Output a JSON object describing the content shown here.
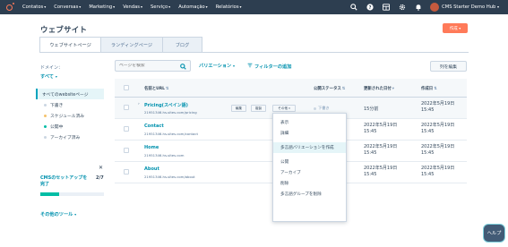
{
  "nav": {
    "items": [
      {
        "label": "Contatos"
      },
      {
        "label": "Conversas"
      },
      {
        "label": "Marketing"
      },
      {
        "label": "Vendas"
      },
      {
        "label": "Serviço"
      },
      {
        "label": "Automação"
      },
      {
        "label": "Relatórios"
      }
    ],
    "hub_name": "CMS Starter Demo Hub"
  },
  "header": {
    "title": "ウェブサイト",
    "create_label": "作成"
  },
  "tabs": [
    {
      "label": "ウェブサイトページ"
    },
    {
      "label": "ランディングページ"
    },
    {
      "label": "ブログ"
    }
  ],
  "sidebar": {
    "domain_label": "ドメイン：",
    "domain_value": "すべて",
    "items": [
      {
        "label": "すべてのwebsiteページ",
        "dot_color": ""
      },
      {
        "label": "下書き",
        "dot_color": "#cbd6e2"
      },
      {
        "label": "スケジュール済み",
        "dot_color": "#f5c26b"
      },
      {
        "label": "公開中",
        "dot_color": "#00bda5"
      },
      {
        "label": "アーカイブ済み",
        "dot_color": "#cbd6e2"
      }
    ],
    "setup_title": "CMSのセットアップを完了",
    "setup_count": "2/7",
    "setup_progress": 0.29,
    "more_tools": "その他のツール"
  },
  "toolbar": {
    "search_placeholder": "ページを検索",
    "variation": "バリエーション",
    "filter": "フィルターの追加",
    "edit_columns": "列を編集"
  },
  "table": {
    "headers": {
      "name": "名前とURL",
      "status": "公開ステータス",
      "updated": "更新された日付",
      "created": "作成日"
    },
    "rows": [
      {
        "name": "Pricing(スペイン語)",
        "url": "21951346.hs-sites.com/pricing",
        "btn_edit": "編集",
        "btn_clone": "複製",
        "btn_more": "その他",
        "status": "下書き",
        "updated": "15分前",
        "created_date": "2022年5月19日",
        "created_time": "15:45"
      },
      {
        "name": "Contact",
        "url": "21951346.hs-sites.com/contact",
        "status": "",
        "updated_date": "2022年5月19日",
        "updated_time": "15:45",
        "created_date": "2022年5月19日",
        "created_time": "15:45"
      },
      {
        "name": "Home",
        "url": "21951346.hs-sites.com",
        "status": "",
        "updated_date": "2022年5月19日",
        "updated_time": "15:45",
        "created_date": "2022年5月19日",
        "created_time": "15:45"
      },
      {
        "name": "About",
        "url": "21951346.hs-sites.com/about",
        "status": "",
        "updated_date": "2022年5月19日",
        "updated_time": "15:45",
        "created_date": "2022年5月19日",
        "created_time": "15:45"
      }
    ]
  },
  "menu": {
    "items": [
      {
        "label": "表示"
      },
      {
        "label": "詳細"
      },
      {
        "label": "多言語バリエーションを作成"
      },
      {
        "label": "公開"
      },
      {
        "label": "アーカイブ"
      },
      {
        "label": "削除"
      },
      {
        "label": "多言語グループを削除"
      }
    ]
  },
  "help_label": "ヘルプ",
  "colors": {
    "nav_bg": "#2d3e50",
    "accent": "#ff7a59",
    "link": "#0091ae",
    "progress": "#00bda5"
  }
}
